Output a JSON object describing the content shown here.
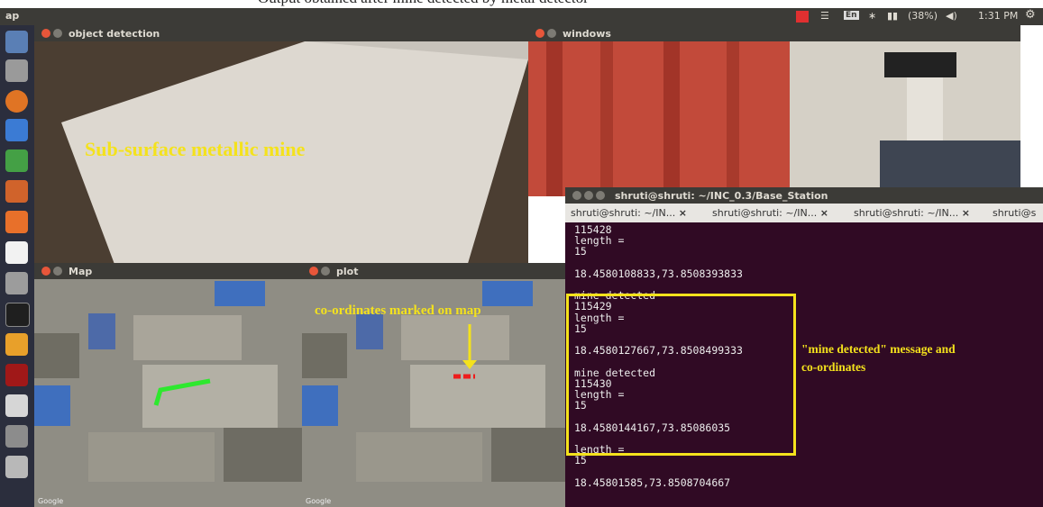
{
  "caption": "Output obtained after mine detected by metal detector",
  "topbar": {
    "app": "ap",
    "keyboard": "En",
    "battery": "(38%)",
    "clock": "1:31 PM",
    "icons": [
      "wifi-icon",
      "bluetooth-icon",
      "battery-icon",
      "volume-icon",
      "settings-gear-icon"
    ]
  },
  "windows": {
    "object_detection": {
      "title": "object detection",
      "overlay": "Sub-surface metallic mine"
    },
    "webcam": {
      "title": "windows"
    },
    "map": {
      "title": "Map",
      "attribution": "Google"
    },
    "plot": {
      "title": "plot",
      "overlay": "co-ordinates marked on map"
    }
  },
  "terminal": {
    "title": "shruti@shruti: ~/INC_0.3/Base_Station",
    "tabs": [
      "shruti@shruti: ~/IN...",
      "shruti@shruti: ~/IN...",
      "shruti@shruti: ~/IN...",
      "shruti@s"
    ],
    "lines": [
      "115428",
      "length =",
      "15",
      "",
      "18.4580108833,73.8508393833",
      "",
      "mine detected",
      "115429",
      "length =",
      "15",
      "",
      "18.4580127667,73.8508499333",
      "",
      "mine detected",
      "115430",
      "length =",
      "15",
      "",
      "18.4580144167,73.85086035",
      "",
      "length =",
      "15",
      "",
      "18.45801585,73.8508704667"
    ]
  },
  "annotation": {
    "line1": "\"mine detected\" message and",
    "line2": "co-ordinates",
    "color": "#f4e21c"
  }
}
